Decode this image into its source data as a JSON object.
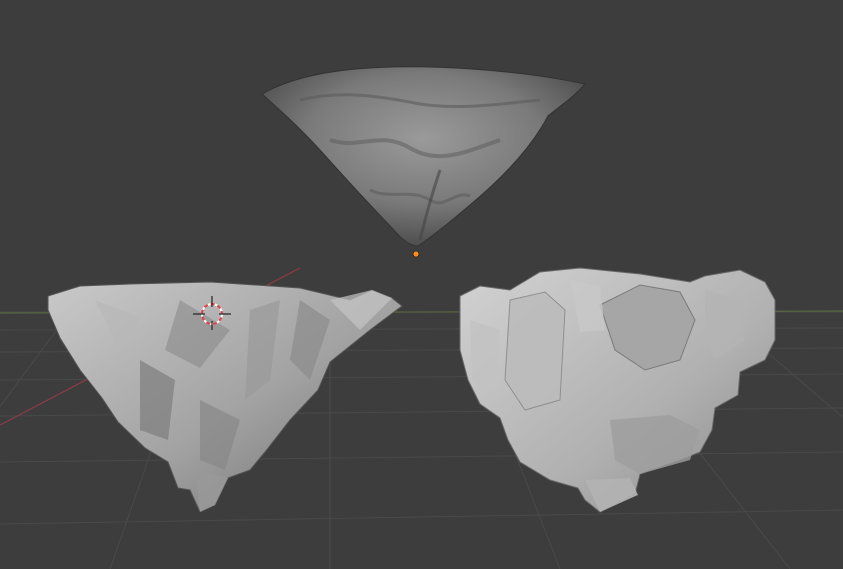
{
  "app": {
    "view": "3d-viewport"
  },
  "colors": {
    "background": "#3d3d3d",
    "grid": "#4a4a4a",
    "grid_dark": "#363636",
    "x_axis": "#8e3b45",
    "y_axis": "#6a8a3a",
    "origin_dot": "#ff8c1a",
    "cursor_red": "#e0404a",
    "cursor_white": "#ffffff"
  },
  "objects": [
    {
      "icon": "rock-mesh-top"
    },
    {
      "icon": "rock-mesh-left"
    },
    {
      "icon": "rock-mesh-right"
    }
  ],
  "overlays": {
    "cursor_icon": "3d-cursor",
    "origin_icon": "object-origin"
  }
}
